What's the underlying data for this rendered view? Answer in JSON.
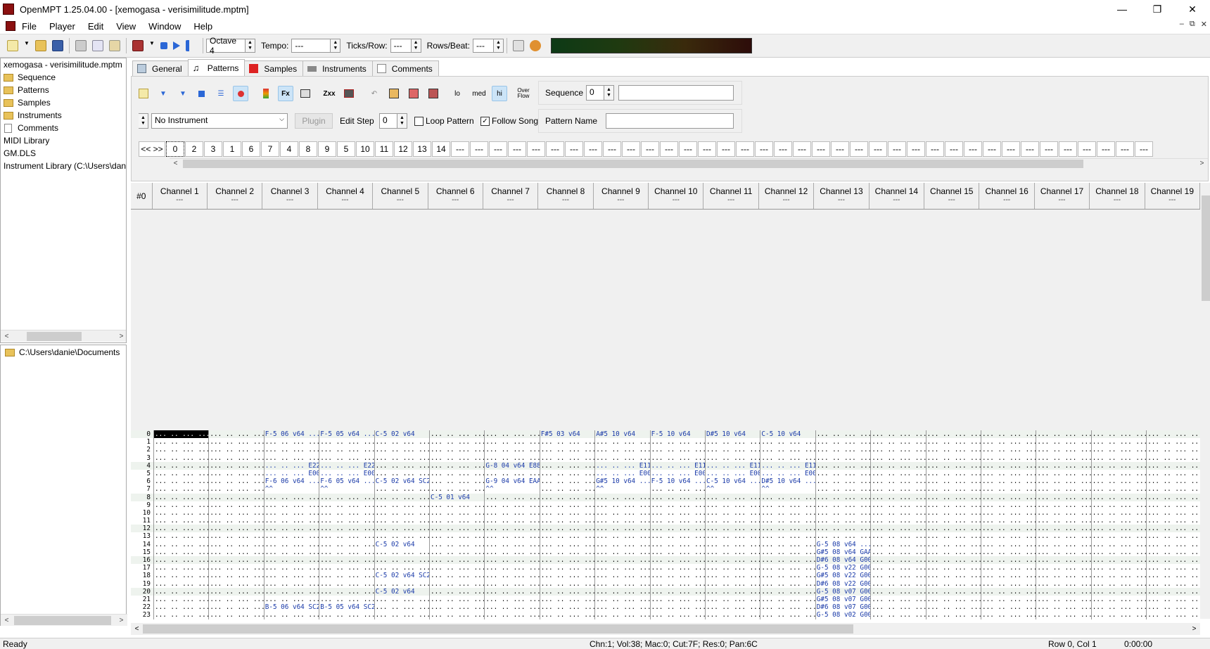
{
  "window": {
    "title": "OpenMPT 1.25.04.00 - [xemogasa - verisimilitude.mptm]",
    "minimize": "—",
    "restore": "❐",
    "close": "✕"
  },
  "menu": [
    "File",
    "Player",
    "Edit",
    "View",
    "Window",
    "Help"
  ],
  "mdi_controls": [
    "–",
    "⧉",
    "✕"
  ],
  "toolbar": {
    "octave": "Octave 4",
    "tempo_label": "Tempo:",
    "tempo_value": "---",
    "ticks_label": "Ticks/Row:",
    "ticks_value": "---",
    "rows_label": "Rows/Beat:",
    "rows_value": "---"
  },
  "tree": {
    "file": "xemogasa - verisimilitude.mptm",
    "items": [
      "Sequence",
      "Patterns",
      "Samples",
      "Instruments",
      "Comments"
    ],
    "midi": "MIDI Library",
    "gm": "GM.DLS",
    "instlib": "Instrument Library (C:\\Users\\dan"
  },
  "filetree": {
    "path": "C:\\Users\\danie\\Documents"
  },
  "tabs": [
    "General",
    "Patterns",
    "Samples",
    "Instruments",
    "Comments"
  ],
  "pattern_toolbar": {
    "lo": "lo",
    "med": "med",
    "hi": "hi",
    "overflow": "Over Flow",
    "fx": "Fx",
    "zxx": "Zxx",
    "sequence_label": "Sequence",
    "sequence_value": "0",
    "instrument": "No Instrument",
    "plugin": "Plugin",
    "editstep_label": "Edit Step",
    "editstep_value": "0",
    "loop": "Loop Pattern",
    "follow": "Follow Song",
    "pattern_name_label": "Pattern Name",
    "order_nav": "<< >>"
  },
  "orders": [
    "0",
    "2",
    "3",
    "1",
    "6",
    "7",
    "4",
    "8",
    "9",
    "5",
    "10",
    "11",
    "12",
    "13",
    "14",
    "---",
    "---",
    "---",
    "---",
    "---",
    "---",
    "---",
    "---",
    "---",
    "---",
    "---",
    "---",
    "---",
    "---",
    "---",
    "---",
    "---",
    "---",
    "---",
    "---",
    "---",
    "---",
    "---",
    "---",
    "---",
    "---",
    "---",
    "---",
    "---",
    "---",
    "---",
    "---",
    "---",
    "---",
    "---",
    "---",
    "---"
  ],
  "pattern_number": "#0",
  "channels": [
    "Channel 1",
    "Channel 2",
    "Channel 3",
    "Channel 4",
    "Channel 5",
    "Channel 6",
    "Channel 7",
    "Channel 8",
    "Channel 9",
    "Channel 10",
    "Channel 11",
    "Channel 12",
    "Channel 13",
    "Channel 14",
    "Channel 15",
    "Channel 16",
    "Channel 17",
    "Channel 18",
    "Channel 19"
  ],
  "channel_sub": "---",
  "pattern_rows": [
    {
      "row": "0",
      "cells": {
        "2": "F-5 06 v64 ...",
        "3": "F-5 05 v64 ...",
        "4": "C-5 02 v64",
        "7": "F#5 03 v64",
        "8": "A#5 10 v64",
        "9": "F-5 10 v64",
        "10": "D#5 10 v64",
        "11": "C-5 10 v64"
      }
    },
    {
      "row": "1",
      "cells": {}
    },
    {
      "row": "2",
      "cells": {}
    },
    {
      "row": "3",
      "cells": {}
    },
    {
      "row": "4",
      "cells": {
        "2": "... .. ... E22",
        "3": "... .. ... E22",
        "6": "G-8 04 v64 E88",
        "8": "... .. ... E11",
        "9": "... .. ... E11",
        "10": "... .. ... E11",
        "11": "... .. ... E11"
      }
    },
    {
      "row": "5",
      "cells": {
        "2": "... .. ... E00",
        "3": "... .. ... E00",
        "8": "... .. ... E00",
        "9": "... .. ... E00",
        "10": "... .. ... E00",
        "11": "... .. ... E00"
      }
    },
    {
      "row": "6",
      "cells": {
        "2": "F-6 06 v64 ...",
        "3": "F-6 05 v64 ...",
        "4": "C-5 02 v64 SC2",
        "6": "G-9 04 v64 EAA",
        "8": "G#5 10 v64 ...",
        "9": "F-5 10 v64 ...",
        "10": "C-5 10 v64 ...",
        "11": "D#5 10 v64 ..."
      }
    },
    {
      "row": "7",
      "cells": {
        "2": "^^",
        "3": "^^",
        "6": "^^",
        "8": "^^",
        "10": "^^",
        "11": "^^"
      }
    },
    {
      "row": "8",
      "cells": {
        "5": "C-5 01 v64"
      }
    },
    {
      "row": "9",
      "cells": {}
    },
    {
      "row": "10",
      "cells": {}
    },
    {
      "row": "11",
      "cells": {}
    },
    {
      "row": "12",
      "cells": {}
    },
    {
      "row": "13",
      "cells": {}
    },
    {
      "row": "14",
      "cells": {
        "4": "C-5 02 v64",
        "12": "G-5 08 v64 ..."
      }
    },
    {
      "row": "15",
      "cells": {
        "12": "G#5 08 v64 GAA"
      }
    },
    {
      "row": "16",
      "cells": {
        "12": "D#6 08 v64 G00"
      }
    },
    {
      "row": "17",
      "cells": {
        "12": "G-5 08 v22 G00"
      }
    },
    {
      "row": "18",
      "cells": {
        "4": "C-5 02 v64 SC2",
        "12": "G#5 08 v22 G00"
      }
    },
    {
      "row": "19",
      "cells": {
        "12": "D#6 08 v22 G00"
      }
    },
    {
      "row": "20",
      "cells": {
        "4": "C-5 02 v64",
        "12": "G-5 08 v07 G00"
      }
    },
    {
      "row": "21",
      "cells": {
        "12": "G#5 08 v07 G00"
      }
    },
    {
      "row": "22",
      "cells": {
        "2": "B-5 06 v64 SC2",
        "3": "B-5 05 v64 SC2",
        "12": "D#6 08 v07 G00"
      }
    },
    {
      "row": "23",
      "cells": {
        "12": "G-5 08 v02 G00"
      }
    }
  ],
  "status": {
    "ready": "Ready",
    "info": "Chn:1; Vol:38; Mac:0; Cut:7F; Res:0; Pan:6C",
    "position": "Row 0, Col 1",
    "time": "0:00:00"
  }
}
